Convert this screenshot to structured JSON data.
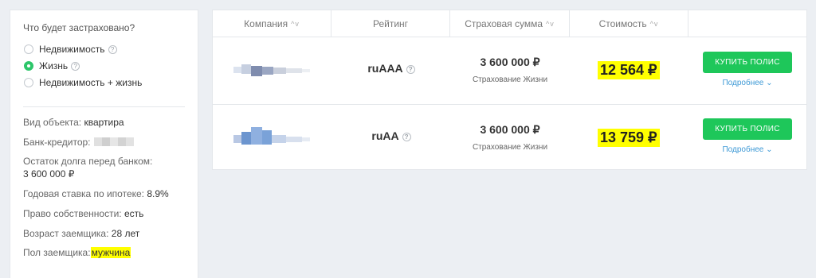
{
  "filters": {
    "question": "Что будет застраховано?",
    "options": [
      {
        "label": "Недвижимость",
        "selected": false,
        "help": true
      },
      {
        "label": "Жизнь",
        "selected": true,
        "help": true
      },
      {
        "label": "Недвижимость + жизнь",
        "selected": false,
        "help": false
      }
    ],
    "details": {
      "object_label": "Вид объекта:",
      "object_value": "квартира",
      "bank_label": "Банк-кредитор:",
      "debt_label": "Остаток долга перед банком:",
      "debt_value": "3 600 000 ₽",
      "rate_label": "Годовая ставка по ипотеке:",
      "rate_value": "8.9%",
      "ownership_label": "Право собственности:",
      "ownership_value": "есть",
      "age_label": "Возраст заемщика:",
      "age_value": "28 лет",
      "gender_label": "Пол заемщика:",
      "gender_value": "мужчина"
    }
  },
  "table": {
    "columns": [
      {
        "label": "Компания",
        "sortable": true
      },
      {
        "label": "Рейтинг",
        "sortable": false
      },
      {
        "label": "Страховая сумма",
        "sortable": true
      },
      {
        "label": "Стоимость",
        "sortable": true
      },
      {
        "label": "",
        "sortable": false
      }
    ],
    "sort_icon": "^v",
    "help_glyph": "?",
    "rows": [
      {
        "rating": "ruAAA",
        "sum": "3 600 000 ₽",
        "kind": "Страхование Жизни",
        "price": "12 564 ₽",
        "buy_label": "КУПИТЬ ПОЛИС",
        "more_label": "Подробнее ⌄"
      },
      {
        "rating": "ruAA",
        "sum": "3 600 000 ₽",
        "kind": "Страхование Жизни",
        "price": "13 759 ₽",
        "buy_label": "КУПИТЬ ПОЛИС",
        "more_label": "Подробнее ⌄"
      }
    ]
  },
  "colors": {
    "accent_green": "#1ec75a",
    "highlight": "#ffff00",
    "link": "#3f9ad6"
  }
}
